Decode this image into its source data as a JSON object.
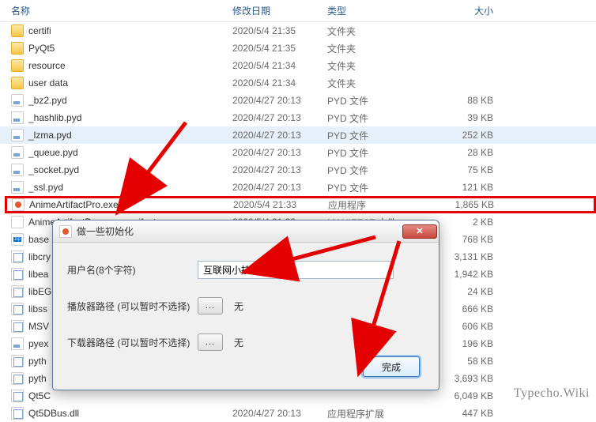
{
  "columns": {
    "name": "名称",
    "date": "修改日期",
    "type": "类型",
    "size": "大小"
  },
  "rows": [
    {
      "icon": "folder",
      "name": "certifi",
      "date": "2020/5/4 21:35",
      "type": "文件夹",
      "size": ""
    },
    {
      "icon": "folder",
      "name": "PyQt5",
      "date": "2020/5/4 21:35",
      "type": "文件夹",
      "size": ""
    },
    {
      "icon": "folder",
      "name": "resource",
      "date": "2020/5/4 21:34",
      "type": "文件夹",
      "size": ""
    },
    {
      "icon": "folder",
      "name": "user data",
      "date": "2020/5/4 21:34",
      "type": "文件夹",
      "size": ""
    },
    {
      "icon": "pyd",
      "name": "_bz2.pyd",
      "date": "2020/4/27 20:13",
      "type": "PYD 文件",
      "size": "88 KB"
    },
    {
      "icon": "pyd",
      "name": "_hashlib.pyd",
      "date": "2020/4/27 20:13",
      "type": "PYD 文件",
      "size": "39 KB"
    },
    {
      "icon": "pyd",
      "name": "_lzma.pyd",
      "date": "2020/4/27 20:13",
      "type": "PYD 文件",
      "size": "252 KB",
      "selected": true
    },
    {
      "icon": "pyd",
      "name": "_queue.pyd",
      "date": "2020/4/27 20:13",
      "type": "PYD 文件",
      "size": "28 KB"
    },
    {
      "icon": "pyd",
      "name": "_socket.pyd",
      "date": "2020/4/27 20:13",
      "type": "PYD 文件",
      "size": "75 KB"
    },
    {
      "icon": "pyd",
      "name": "_ssl.pyd",
      "date": "2020/4/27 20:13",
      "type": "PYD 文件",
      "size": "121 KB"
    },
    {
      "icon": "exe",
      "name": "AnimeArtifactPro.exe",
      "date": "2020/5/4 21:33",
      "type": "应用程序",
      "size": "1,865 KB",
      "highlighted": true
    },
    {
      "icon": "manifest",
      "name": "AnimeArtifactPro.exe.manifest",
      "date": "2020/5/4 21:33",
      "type": "MANIFEST 文件",
      "size": "2 KB"
    },
    {
      "icon": "zip",
      "name": "base",
      "date": "",
      "type": "",
      "size": "768 KB"
    },
    {
      "icon": "dll",
      "name": "libcry",
      "date": "",
      "type": "",
      "size": "3,131 KB"
    },
    {
      "icon": "dll",
      "name": "libea",
      "date": "",
      "type": "",
      "size": "1,942 KB"
    },
    {
      "icon": "dll",
      "name": "libEG",
      "date": "",
      "type": "",
      "size": "24 KB"
    },
    {
      "icon": "dll",
      "name": "libss",
      "date": "",
      "type": "",
      "size": "666 KB"
    },
    {
      "icon": "dll",
      "name": "MSV",
      "date": "",
      "type": "",
      "size": "606 KB"
    },
    {
      "icon": "pyd",
      "name": "pyex",
      "date": "",
      "type": "",
      "size": "196 KB"
    },
    {
      "icon": "dll",
      "name": "pyth",
      "date": "",
      "type": "",
      "size": "58 KB"
    },
    {
      "icon": "dll",
      "name": "pyth",
      "date": "",
      "type": "",
      "size": "3,693 KB"
    },
    {
      "icon": "dll",
      "name": "Qt5C",
      "date": "",
      "type": "",
      "size": "6,049 KB"
    },
    {
      "icon": "dll",
      "name": "Qt5DBus.dll",
      "date": "2020/4/27 20:13",
      "type": "应用程序扩展",
      "size": "447 KB"
    }
  ],
  "dialog": {
    "title": "做一些初始化",
    "username_label": "用户名(8个字符)",
    "username_value": "互联网小技巧",
    "player_label": "播放器路径 (可以暂时不选择)",
    "downloader_label": "下载器路径 (可以暂时不选择)",
    "browse": "...",
    "none": "无",
    "done": "完成"
  },
  "watermark": "Typecho.Wiki"
}
